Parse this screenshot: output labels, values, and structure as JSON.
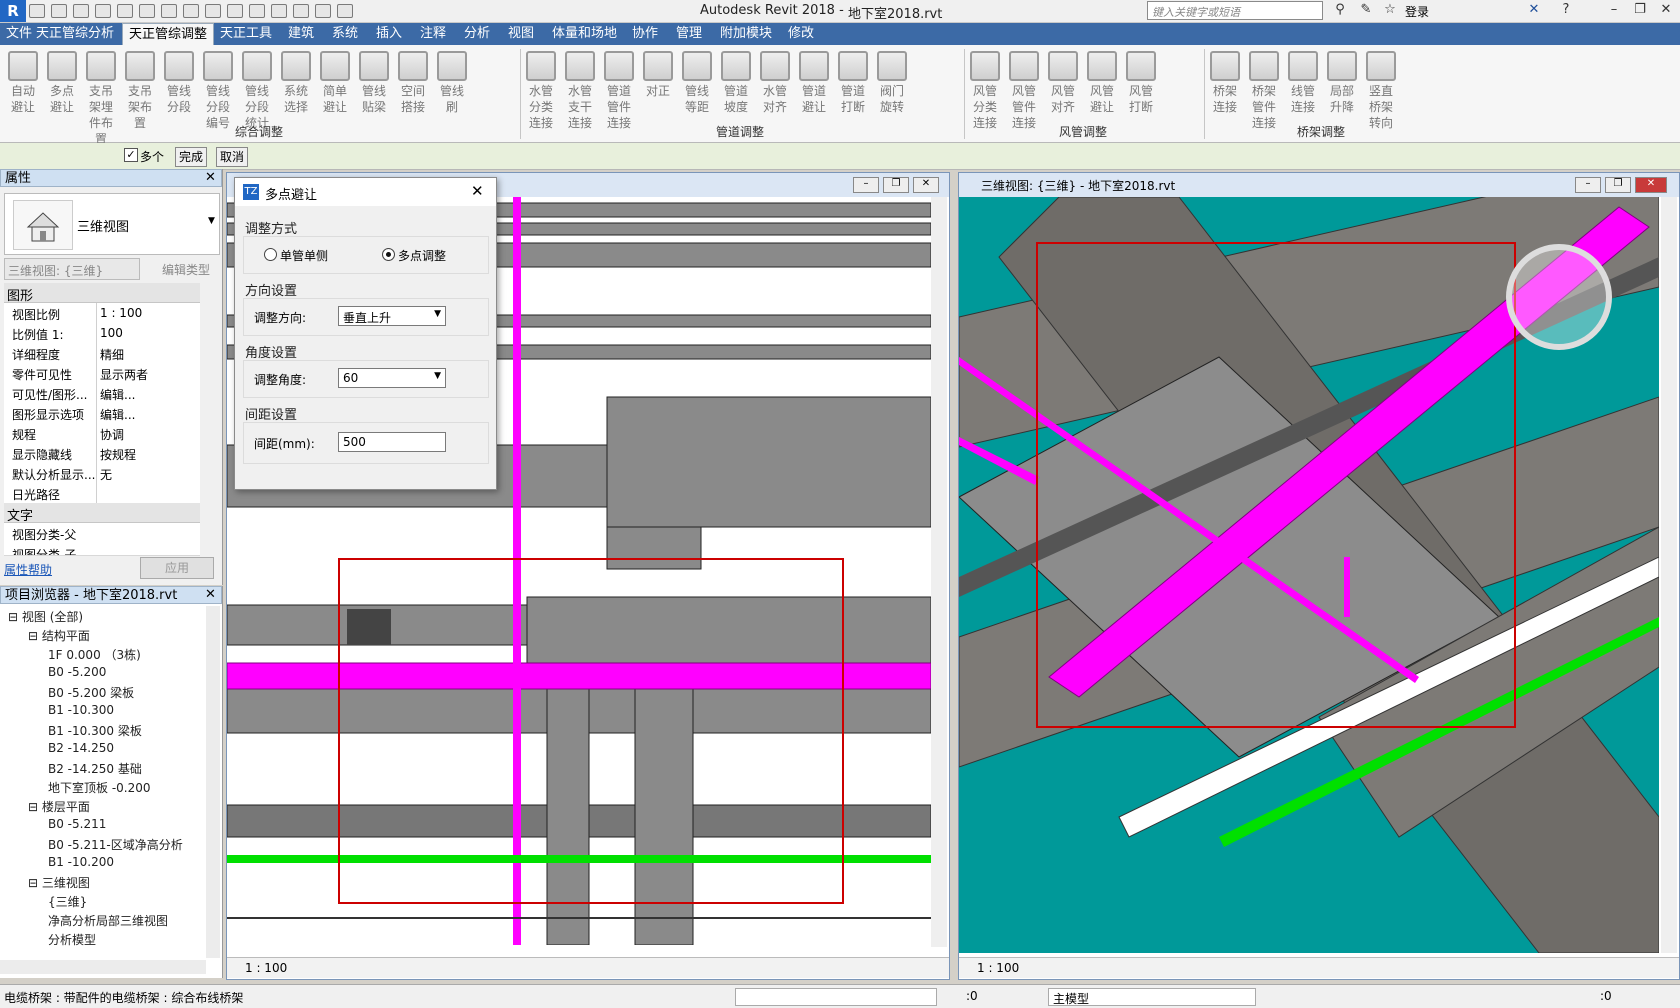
{
  "app": {
    "name": "Autodesk Revit 2018 -",
    "document": "地下室2018.rvt",
    "search_placeholder": "键入关键字或短语",
    "login": "登录"
  },
  "tabs": [
    "文件",
    "天正管综分析",
    "天正管综调整",
    "天正工具",
    "建筑",
    "系统",
    "插入",
    "注释",
    "分析",
    "视图",
    "体量和场地",
    "协作",
    "管理",
    "附加模块",
    "修改"
  ],
  "active_tab": "天正管综调整",
  "ribbon": {
    "groups": [
      {
        "label": "综合调整",
        "buttons": [
          "自动避让",
          "多点避让",
          "支吊架埋件布置",
          "支吊架布置",
          "管线分段",
          "管线分段编号",
          "管线分段统计",
          "系统选择",
          "简单避让",
          "管线贴梁",
          "空间搭接",
          "管线刷"
        ]
      },
      {
        "label": "管道调整",
        "buttons": [
          "水管分类连接",
          "水管支干连接",
          "管道管件连接",
          "对正",
          "管线等距",
          "管道坡度",
          "水管对齐",
          "管道避让",
          "管道打断",
          "阀门旋转"
        ]
      },
      {
        "label": "风管调整",
        "buttons": [
          "风管分类连接",
          "风管管件连接",
          "风管对齐",
          "风管避让",
          "风管打断"
        ]
      },
      {
        "label": "桥架调整",
        "buttons": [
          "桥架连接",
          "桥架管件连接",
          "线管连接",
          "局部升降",
          "竖直桥架转向"
        ]
      }
    ]
  },
  "options_bar": {
    "multi_label": "多个",
    "multi_checked": true,
    "finish": "完成",
    "cancel": "取消"
  },
  "properties": {
    "title": "属性",
    "type_name": "三维视图",
    "selector": "三维视图: {三维}",
    "edit_type": "编辑类型",
    "group_graphics": "图形",
    "rows": [
      {
        "k": "视图比例",
        "v": "1 : 100"
      },
      {
        "k": "比例值 1:",
        "v": "100"
      },
      {
        "k": "详细程度",
        "v": "精细"
      },
      {
        "k": "零件可见性",
        "v": "显示两者"
      },
      {
        "k": "可见性/图形...",
        "v": "编辑..."
      },
      {
        "k": "图形显示选项",
        "v": "编辑..."
      },
      {
        "k": "规程",
        "v": "协调"
      },
      {
        "k": "显示隐藏线",
        "v": "按规程"
      },
      {
        "k": "默认分析显示...",
        "v": "无"
      },
      {
        "k": "日光路径",
        "v": ""
      }
    ],
    "group_text": "文字",
    "text_rows": [
      {
        "k": "视图分类-父",
        "v": ""
      },
      {
        "k": "视图分类-子",
        "v": ""
      }
    ],
    "help": "属性帮助",
    "apply": "应用"
  },
  "browser": {
    "title": "项目浏览器 - 地下室2018.rvt",
    "nodes": [
      {
        "t": "视图 (全部)",
        "lvl": 0
      },
      {
        "t": "结构平面",
        "lvl": 1
      },
      {
        "t": "1F 0.000  （3栋)",
        "lvl": 2
      },
      {
        "t": "B0 -5.200",
        "lvl": 2
      },
      {
        "t": "B0 -5.200 梁板",
        "lvl": 2
      },
      {
        "t": "B1 -10.300",
        "lvl": 2
      },
      {
        "t": "B1 -10.300 梁板",
        "lvl": 2
      },
      {
        "t": "B2 -14.250",
        "lvl": 2
      },
      {
        "t": "B2 -14.250 基础",
        "lvl": 2
      },
      {
        "t": "地下室顶板 -0.200",
        "lvl": 2
      },
      {
        "t": "楼层平面",
        "lvl": 1
      },
      {
        "t": "B0 -5.211",
        "lvl": 2
      },
      {
        "t": "B0 -5.211-区域净高分析",
        "lvl": 2
      },
      {
        "t": "B1 -10.200",
        "lvl": 2
      },
      {
        "t": "三维视图",
        "lvl": 1
      },
      {
        "t": "{三维}",
        "lvl": 2
      },
      {
        "t": "净高分析局部三维视图",
        "lvl": 2
      },
      {
        "t": "分析模型",
        "lvl": 2
      }
    ]
  },
  "dialog": {
    "title": "多点避让",
    "adjust_mode": "调整方式",
    "radio_single": "单管单侧",
    "radio_multi": "多点调整",
    "selected_mode": "多点调整",
    "direction_section": "方向设置",
    "direction_label": "调整方向:",
    "direction_value": "垂直上升",
    "angle_section": "角度设置",
    "angle_label": "调整角度:",
    "angle_value": "60",
    "spacing_section": "间距设置",
    "spacing_label": "间距(mm):",
    "spacing_value": "500"
  },
  "view_left": {
    "scale": "1 : 100"
  },
  "view_right": {
    "title": "三维视图: {三维} - 地下室2018.rvt",
    "scale": "1 : 100"
  },
  "statusbar": {
    "text": "电缆桥架 : 带配件的电缆桥架 : 综合布线桥架",
    "sel_count": ":0",
    "workset": "主模型",
    "filter_count": ":0"
  },
  "colors": {
    "pipe": "#ff00ff",
    "green_pipe": "#00e000",
    "teal": "#009999",
    "selection": "#cc0000",
    "concrete": "#7d7d7d"
  }
}
